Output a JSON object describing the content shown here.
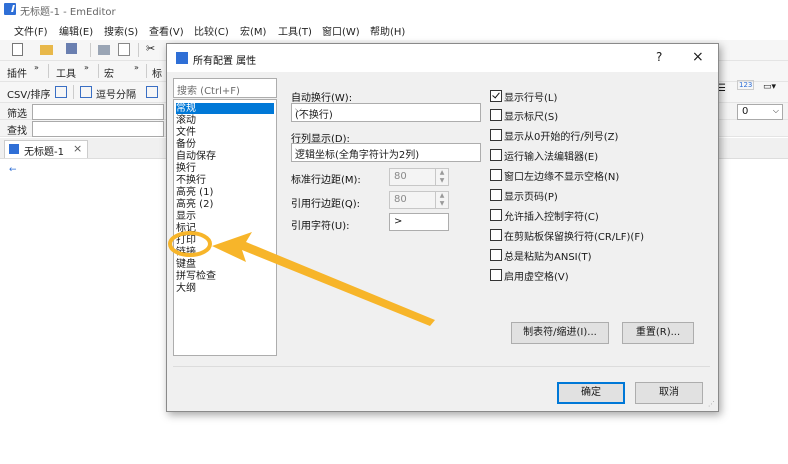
{
  "window": {
    "title": "无标题-1 - EmEditor"
  },
  "menu": [
    "文件(F)",
    "编辑(E)",
    "搜索(S)",
    "查看(V)",
    "比较(C)",
    "宏(M)",
    "工具(T)",
    "窗口(W)",
    "帮助(H)"
  ],
  "toolbars": {
    "row2": {
      "plugins": "插件",
      "tools": "工具",
      "macros": "宏",
      "mark": "标"
    },
    "row3": {
      "csv": "CSV/排序",
      "comma": "逗号分隔"
    },
    "filter_label": "筛选",
    "find_label": "查找"
  },
  "tab": {
    "label": "无标题-1",
    "close": "×"
  },
  "right_widgets": {
    "numbers": "123",
    "num_value": "0"
  },
  "dialog": {
    "title": "所有配置 属性",
    "help": "?",
    "close": "×",
    "search_placeholder": "搜索 (Ctrl+F)",
    "categories": [
      "常规",
      "滚动",
      "文件",
      "备份",
      "自动保存",
      "换行",
      "不换行",
      "高亮 (1)",
      "高亮 (2)",
      "显示",
      "标记",
      "打印",
      "链接",
      "键盘",
      "拼写检查",
      "大纲"
    ],
    "selected_category": "常规",
    "auto_wrap_label": "自动换行(W):",
    "auto_wrap_value": "(不换行)",
    "column_display_label": "行列显示(D):",
    "column_display_value": "逻辑坐标(全角字符计为2列)",
    "margin_label": "标准行边距(M):",
    "margin_value": "80",
    "quote_margin_label": "引用行边距(Q):",
    "quote_margin_value": "80",
    "quote_char_label": "引用字符(U):",
    "quote_char_value": ">",
    "checkboxes": [
      {
        "label": "显示行号(L)",
        "checked": true
      },
      {
        "label": "显示标尺(S)",
        "checked": false
      },
      {
        "label": "显示从0开始的行/列号(Z)",
        "checked": false
      },
      {
        "label": "运行输入法编辑器(E)",
        "checked": false
      },
      {
        "label": "窗口左边缘不显示空格(N)",
        "checked": false
      },
      {
        "label": "显示页码(P)",
        "checked": false
      },
      {
        "label": "允许插入控制字符(C)",
        "checked": false
      },
      {
        "label": "在剪贴板保留换行符(CR/LF)(F)",
        "checked": false
      },
      {
        "label": "总是粘贴为ANSI(T)",
        "checked": false
      },
      {
        "label": "启用虚空格(V)",
        "checked": false
      }
    ],
    "tab_indent_button": "制表符/缩进(I)...",
    "reset_button": "重置(R)...",
    "ok_button": "确定",
    "cancel_button": "取消"
  },
  "annotation": {
    "highlighted_item": "标记",
    "color": "#f7b52a"
  }
}
